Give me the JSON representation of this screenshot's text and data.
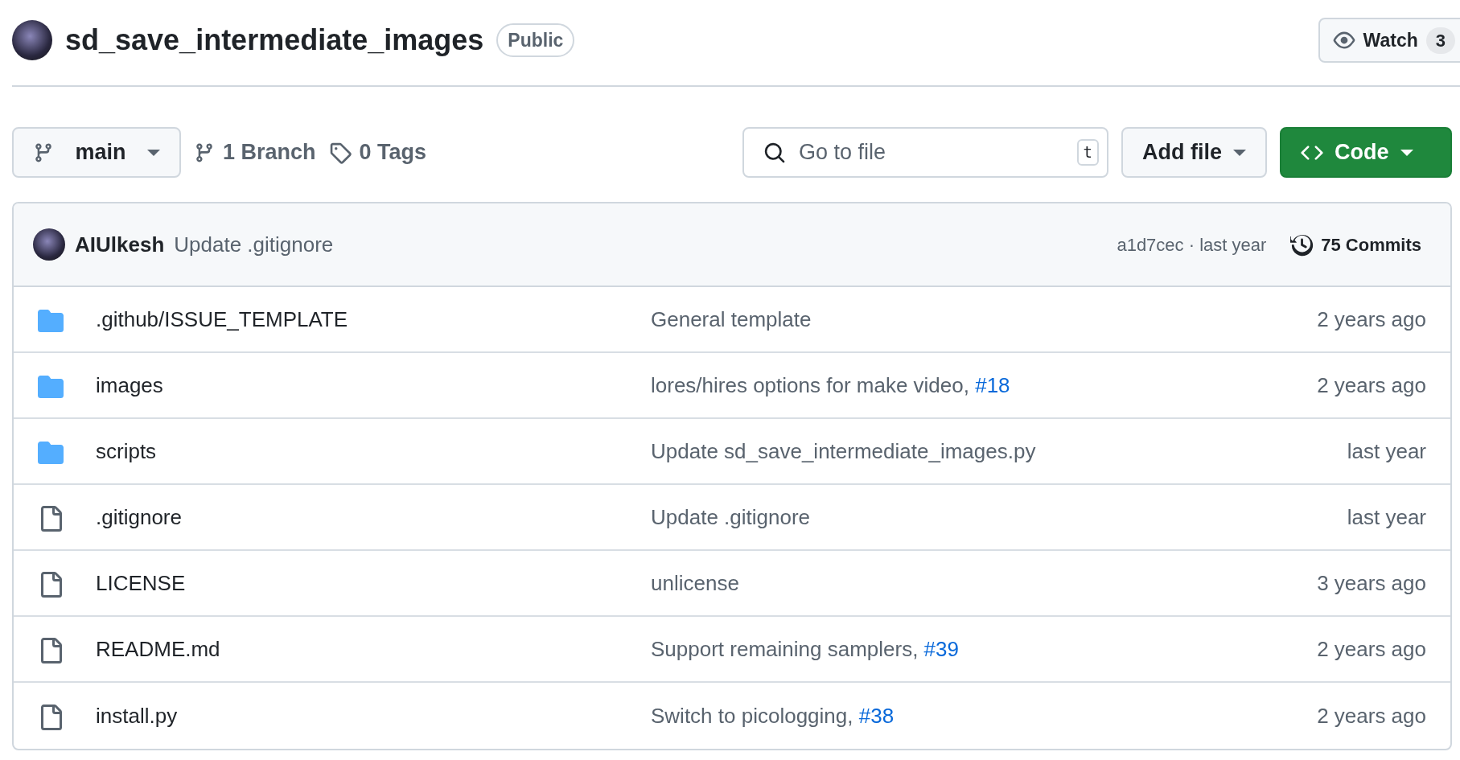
{
  "repo": {
    "name": "sd_save_intermediate_images",
    "visibility": "Public"
  },
  "watch": {
    "label": "Watch",
    "count": "3"
  },
  "toolbar": {
    "branch": "main",
    "branches": "1 Branch",
    "tags": "0 Tags",
    "search_placeholder": "Go to file",
    "shortcut": "t",
    "add_file": "Add file",
    "code": "Code"
  },
  "latest_commit": {
    "author": "AIUlkesh",
    "message": "Update .gitignore",
    "hash_time": "a1d7cec · last year",
    "commits": "75 Commits"
  },
  "files": [
    {
      "kind": "folder",
      "name": ".github/ISSUE_TEMPLATE",
      "message": "General template",
      "time": "2 years ago"
    },
    {
      "kind": "folder",
      "name": "images",
      "message": "lores/hires options for make video, ",
      "link": "#18",
      "time": "2 years ago"
    },
    {
      "kind": "folder",
      "name": "scripts",
      "message": "Update sd_save_intermediate_images.py",
      "time": "last year"
    },
    {
      "kind": "file",
      "name": ".gitignore",
      "message": "Update .gitignore",
      "time": "last year"
    },
    {
      "kind": "file",
      "name": "LICENSE",
      "message": "unlicense",
      "time": "3 years ago"
    },
    {
      "kind": "file",
      "name": "README.md",
      "message": "Support remaining samplers, ",
      "link": "#39",
      "time": "2 years ago"
    },
    {
      "kind": "file",
      "name": "install.py",
      "message": "Switch to picologging, ",
      "link": "#38",
      "time": "2 years ago"
    }
  ]
}
